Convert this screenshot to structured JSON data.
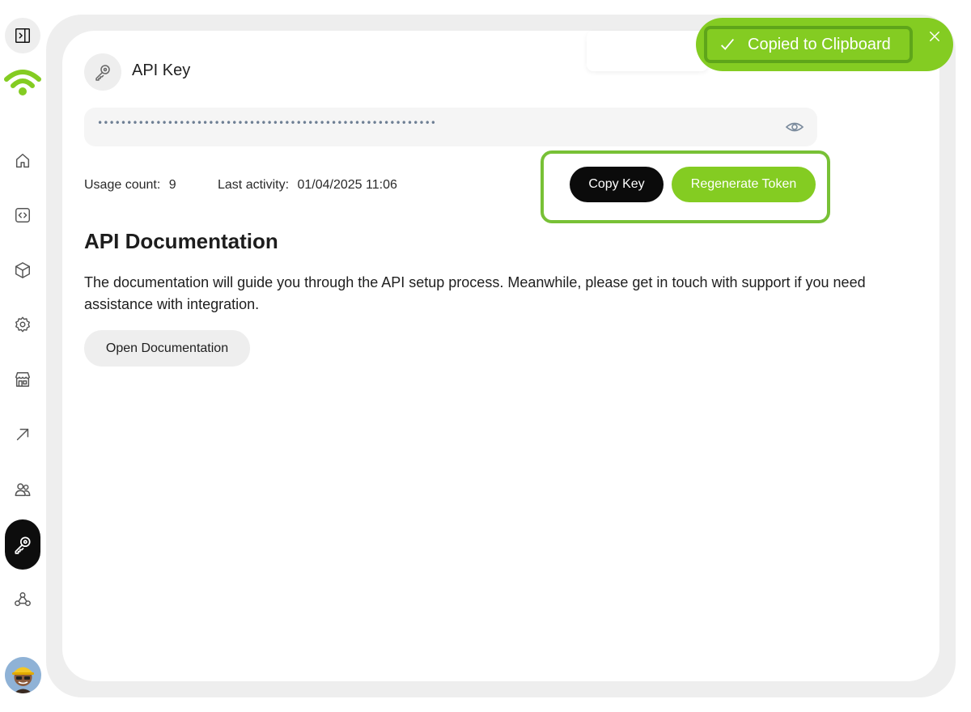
{
  "sidebar": {
    "items": [
      {
        "name": "collapse-sidebar",
        "icon": "panel-right-icon"
      },
      {
        "name": "home",
        "icon": "home-icon"
      },
      {
        "name": "code",
        "icon": "code-icon"
      },
      {
        "name": "products",
        "icon": "cube-icon"
      },
      {
        "name": "settings",
        "icon": "gear-icon"
      },
      {
        "name": "store",
        "icon": "store-icon"
      },
      {
        "name": "growth",
        "icon": "arrow-up-right-icon"
      },
      {
        "name": "users",
        "icon": "users-icon"
      },
      {
        "name": "api-key",
        "icon": "key-icon",
        "active": true
      },
      {
        "name": "webhooks",
        "icon": "webhook-icon"
      }
    ],
    "accent_color": "#84cc22"
  },
  "api_key": {
    "title": "API Key",
    "masked_value": "••••••••••••••••••••••••••••••••••••••••••••••••••••••••••",
    "usage_label": "Usage count:",
    "usage_value": "9",
    "activity_label": "Last activity:",
    "activity_value": "01/04/2025 11:06",
    "copy_label": "Copy Key",
    "regenerate_label": "Regenerate Token"
  },
  "docs": {
    "title": "API Documentation",
    "text": "The documentation will guide you through the API setup process. Meanwhile, please get in touch with support if you need assistance with integration.",
    "button_label": "Open Documentation"
  },
  "toast": {
    "message": "Copied to Clipboard",
    "color": "#84cc22"
  }
}
